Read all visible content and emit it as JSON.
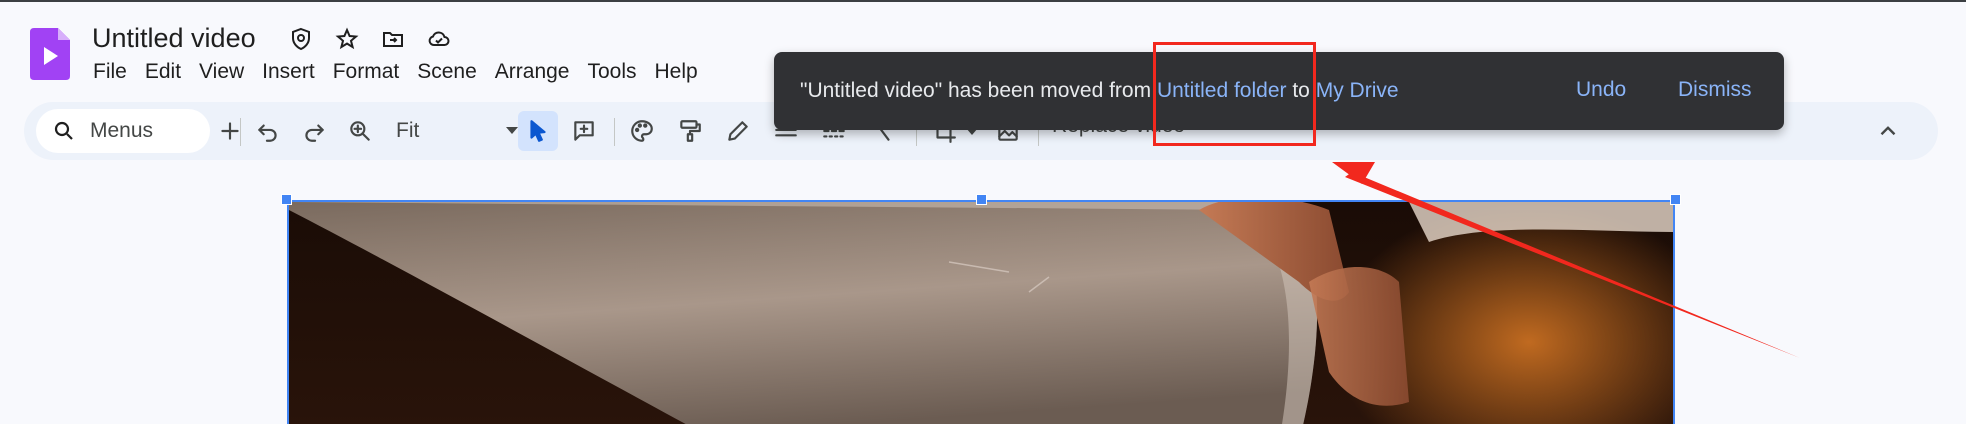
{
  "app": {
    "title": "Untitled video",
    "accent_color": "#a142f4"
  },
  "title_icons": [
    "shield-icon",
    "star-icon",
    "move-to-folder-icon",
    "cloud-saved-icon"
  ],
  "menubar": {
    "items": [
      "File",
      "Edit",
      "View",
      "Insert",
      "Format",
      "Scene",
      "Arrange",
      "Tools",
      "Help"
    ]
  },
  "toolbar": {
    "search_label": "Menus",
    "zoom_value": "Fit",
    "replace_video_label": "Replace video"
  },
  "toast": {
    "message_prefix": "\"Untitled video\" has been moved from ",
    "source_folder": "Untitled folder",
    "connector": " to ",
    "destination": "My Drive",
    "undo_label": "Undo",
    "dismiss_label": "Dismiss"
  },
  "colors": {
    "selection": "#4285f4",
    "link": "#8ab4f8",
    "annotation": "#f2281e"
  }
}
